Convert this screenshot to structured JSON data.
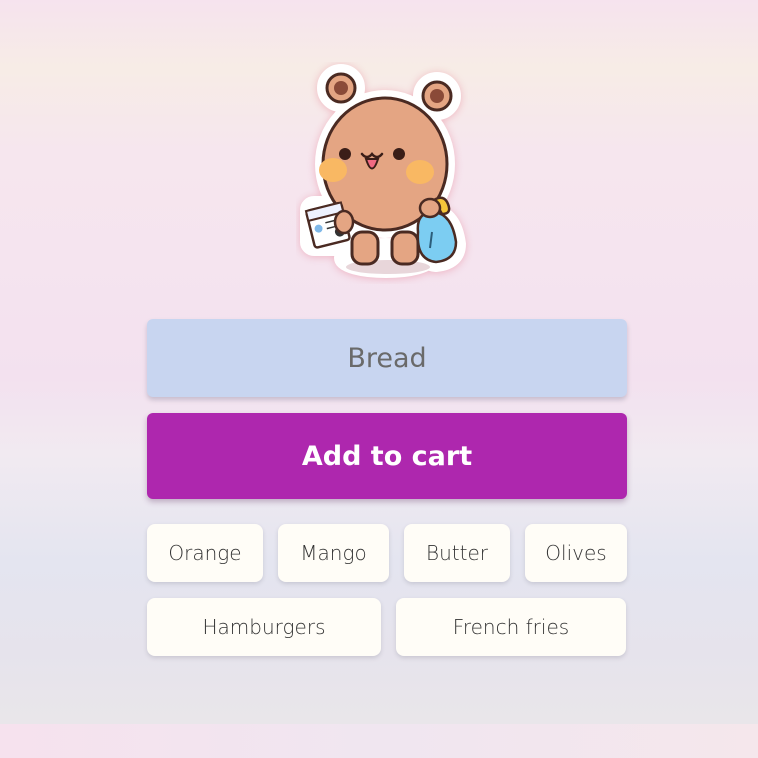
{
  "mascot": {
    "icon": "bear-with-milk-and-bag-icon"
  },
  "item_input": {
    "value": "Bread"
  },
  "add_button": {
    "label": "Add to cart"
  },
  "suggestions": {
    "row1": [
      "Orange",
      "Mango",
      "Butter",
      "Olives"
    ],
    "row2": [
      "Hamburgers",
      "French fries"
    ]
  },
  "colors": {
    "input_background": "#c8d5f0",
    "button_background": "#ae27ae",
    "chip_background": "#fffdf7"
  }
}
